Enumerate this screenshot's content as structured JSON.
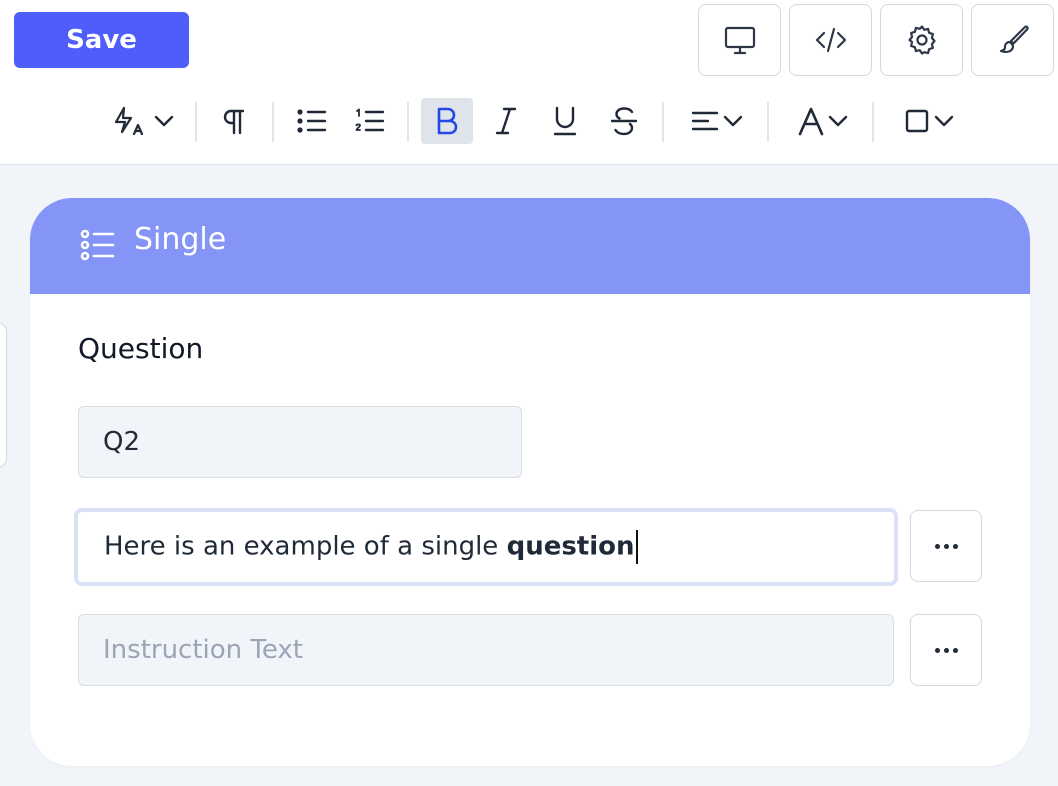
{
  "toolbar": {
    "save_label": "Save",
    "icons": [
      "monitor-icon",
      "code-icon",
      "gear-icon",
      "brush-icon"
    ]
  },
  "format_bar": {
    "items": [
      "text-style-icon",
      "paragraph-icon",
      "bulleted-list-icon",
      "numbered-list-icon",
      "bold-icon",
      "italic-icon",
      "underline-icon",
      "strikethrough-icon",
      "align-icon",
      "font-color-icon",
      "border-icon"
    ],
    "active": "bold-icon"
  },
  "card": {
    "title": "Single",
    "question_label": "Question",
    "question_id_value": "Q2",
    "question_text_regular": "Here is an example of a single ",
    "question_text_bold": "question",
    "instruction_placeholder": "Instruction Text"
  },
  "colors": {
    "accent": "#4f5dfb",
    "header": "#8594f7",
    "background": "#f1f4f9"
  }
}
